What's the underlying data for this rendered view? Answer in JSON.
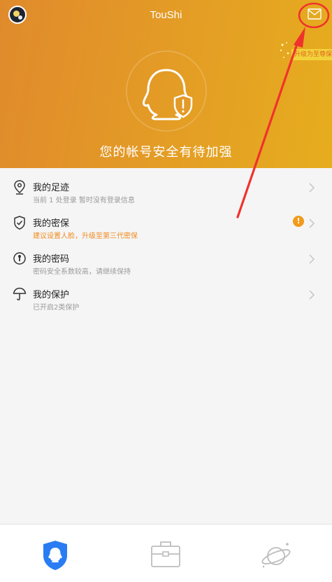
{
  "header": {
    "title": "TouShi",
    "upgrade_tag": "升级为至尊保",
    "status_text": "您的帐号安全有待加强"
  },
  "icons": {
    "avatar": "avatar-image",
    "mail": "mail-icon",
    "hero": "qq-shield-icon"
  },
  "menu": [
    {
      "label": "我的足迹",
      "sub": "当前 1 处登录 暂时没有登录信息",
      "icon": "location-pin-icon"
    },
    {
      "label": "我的密保",
      "sub": "建议设置人脸，升级至第三代密保",
      "icon": "shield-check-icon",
      "alert": "!"
    },
    {
      "label": "我的密码",
      "sub": "密码安全系数较高，请继续保持",
      "icon": "key-icon"
    },
    {
      "label": "我的保护",
      "sub": "已开启2类保护",
      "icon": "umbrella-icon"
    }
  ],
  "tabs": [
    {
      "icon": "qq-shield-tab-icon",
      "active": true
    },
    {
      "icon": "toolbox-icon",
      "active": false
    },
    {
      "icon": "planet-icon",
      "active": false
    }
  ],
  "colors": {
    "header_start": "#e08a2c",
    "header_end": "#e6ad1e",
    "warning": "#f08a1e",
    "active_tab": "#2a7cf3",
    "annotation": "#f0322c"
  }
}
